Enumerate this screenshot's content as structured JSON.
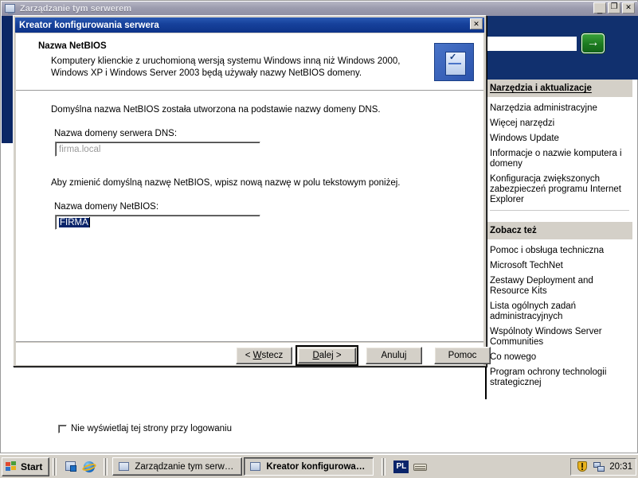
{
  "background_window": {
    "title": "Zarządzanie tym serwerem",
    "title_icon": "server-icon",
    "minimize_label": "_",
    "maximize_label": "❐",
    "close_label": "✕",
    "search": {
      "value": "",
      "placeholder": ""
    },
    "go_button": {
      "label": "→",
      "icon": "green-arrow-icon"
    },
    "panels": [
      {
        "id": "tools",
        "heading": "Narzędzia i aktualizacje",
        "heading_accel": "N",
        "links": [
          "Narzędzia administracyjne",
          "Więcej narzędzi",
          "Windows Update",
          "Informacje o nazwie komputera i domeny",
          "Konfiguracja zwiększonych zabezpieczeń programu Internet Explorer"
        ]
      },
      {
        "id": "see-also",
        "heading": "Zobacz też",
        "heading_accel": "Z",
        "links": [
          "Pomoc i obsługa techniczna",
          "Microsoft TechNet",
          "Zestawy Deployment and Resource Kits",
          "Lista ogólnych zadań administracyjnych",
          "Wspólnoty Windows Server Communities",
          "Co nowego",
          "Program ochrony technologii strategicznej"
        ]
      }
    ],
    "bottom_checkbox": {
      "label": "Nie wyświetlaj tej strony przy logowaniu",
      "checked": false
    }
  },
  "dialog": {
    "title": "Kreator konfigurowania serwera",
    "close_label": "✕",
    "header": {
      "title": "Nazwa NetBIOS",
      "description": "Komputery klienckie z uruchomioną wersją systemu Windows inną niż Windows 2000, Windows XP i Windows Server 2003 będą używały nazwy NetBIOS domeny.",
      "icon": "server-wizard-icon"
    },
    "body": {
      "intro_text": "Domyślna nazwa NetBIOS została utworzona na podstawie nazwy domeny DNS.",
      "dns_label": "Nazwa domeny serwera DNS:",
      "dns_value": "firma.local",
      "dns_disabled": true,
      "change_text": "Aby zmienić domyślną nazwę NetBIOS, wpisz nową nazwę w polu tekstowym poniżej.",
      "netbios_label": "Nazwa domeny NetBIOS:",
      "netbios_label_accel": "a",
      "netbios_value": "FIRMA",
      "netbios_selected": true
    },
    "buttons": [
      {
        "id": "back",
        "label_pre": "< ",
        "label_accel": "W",
        "label_post": "stecz",
        "default": false
      },
      {
        "id": "next",
        "label_pre": "",
        "label_accel": "D",
        "label_post": "alej >",
        "default": true
      },
      {
        "id": "cancel",
        "label_pre": "",
        "label_accel": "",
        "label_post": "Anuluj",
        "default": false
      },
      {
        "id": "help",
        "label_pre": "",
        "label_accel": "",
        "label_post": "Pomoc",
        "default": false
      }
    ]
  },
  "taskbar": {
    "start_label": "Start",
    "quick_launch": [
      "show-desktop-icon",
      "internet-explorer-icon"
    ],
    "tasks": [
      {
        "label": "Zarządzanie tym serwerem",
        "icon": "server-icon",
        "active": false
      },
      {
        "label": "Kreator konfigurowan...",
        "icon": "server-icon",
        "active": true
      }
    ],
    "language": "PL",
    "tray_icons": [
      "keyboard-icon",
      "warning-shield-icon",
      "network-icon"
    ],
    "clock": "20:31"
  },
  "colors": {
    "dialog_face": "#d4d0c8",
    "dialog_title_blue": "#0d3389",
    "bg_title_inactive": "#9c9cae",
    "panel_header": "#d4d0c8",
    "selection_blue": "#0a246a",
    "go_green": "#1c7a20",
    "brand_dark_blue": "#11306e"
  }
}
